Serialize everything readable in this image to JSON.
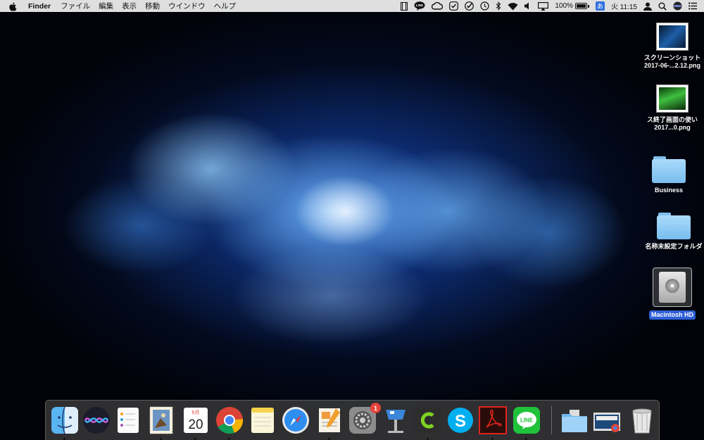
{
  "menubar": {
    "app_name": "Finder",
    "menus": [
      "ファイル",
      "編集",
      "表示",
      "移動",
      "ウインドウ",
      "ヘルプ"
    ],
    "status": {
      "line_label": "LINE",
      "battery": "100%",
      "ime": "あ",
      "clock": "火 11:15"
    }
  },
  "desktop": {
    "icons": [
      {
        "label_line1": "スクリーンショット",
        "label_line2": "2017-06-...2.12.png"
      },
      {
        "label_line1": "ス終了画面の使い",
        "label_line2": "2017...0.png"
      },
      {
        "label_line1": "Business"
      },
      {
        "label_line1": "名称未設定フォルダ"
      },
      {
        "label_line1": "Macintosh HD"
      }
    ]
  },
  "dock": {
    "calendar_month": "6月",
    "calendar_day": "20",
    "system_prefs_badge": "1"
  },
  "colors": {
    "selection": "#2e5fd8",
    "folder": "#8ccbf4",
    "badge": "#e6423a"
  }
}
